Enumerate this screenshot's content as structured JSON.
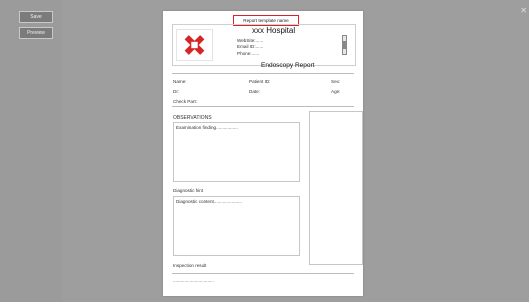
{
  "toolbar": {
    "save_label": "Save",
    "preview_label": "Preview"
  },
  "report": {
    "template_name": "Report template name",
    "hospital_name": "xxx Hospital",
    "website": "WebSite:......",
    "email": "Email ID:......",
    "phone": "Phone:......",
    "title": "Endoscopy Report",
    "fields": {
      "name": "Name:",
      "patient_id": "Patient ID:",
      "sex": "Sex:",
      "dr": "Dr:",
      "date": "Date:",
      "age": "Age:",
      "check_part": "Check Part:"
    },
    "observations_label": "OBSERVATIONS",
    "examination_finding": "Examination finding.................",
    "diagnostic_hint_label": "Diagnostic hint",
    "diagnostic_content": "Diagnostic content......................",
    "inspection_result_label": "Inspection result",
    "inspection_result_value": "................................"
  },
  "colors": {
    "highlight_border": "#d42626",
    "logo_red": "#d42626",
    "background": "#9e9e9e"
  }
}
